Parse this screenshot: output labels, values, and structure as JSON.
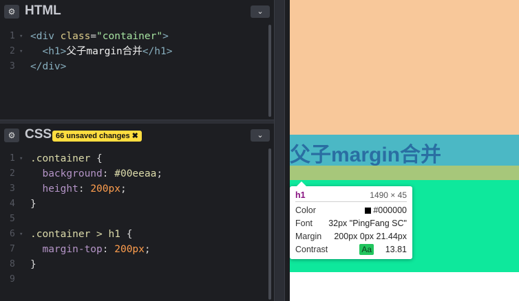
{
  "html_panel": {
    "title": "HTML",
    "lines": [
      {
        "n": "1",
        "parts": [
          {
            "t": "<div ",
            "c": "c-tag"
          },
          {
            "t": "class",
            "c": "c-attr"
          },
          {
            "t": "=",
            "c": "c-punc"
          },
          {
            "t": "\"container\"",
            "c": "c-str"
          },
          {
            "t": ">",
            "c": "c-tag"
          }
        ]
      },
      {
        "n": "2",
        "parts": [
          {
            "t": "  <h1>",
            "c": "c-tag"
          },
          {
            "t": "父子margin合并",
            "c": "c-txt"
          },
          {
            "t": "</h1>",
            "c": "c-tag"
          }
        ]
      },
      {
        "n": "3",
        "parts": [
          {
            "t": "</div>",
            "c": "c-tag"
          }
        ]
      }
    ]
  },
  "css_panel": {
    "title": "CSS",
    "badge": "66 unsaved changes ✖",
    "lines": [
      {
        "n": "1",
        "parts": [
          {
            "t": ".container ",
            "c": "c-sel"
          },
          {
            "t": "{",
            "c": "c-punc"
          }
        ]
      },
      {
        "n": "2",
        "parts": [
          {
            "t": "  background",
            "c": "c-prop"
          },
          {
            "t": ": ",
            "c": "c-punc"
          },
          {
            "t": "#00eeaa",
            "c": "c-sel"
          },
          {
            "t": ";",
            "c": "c-punc"
          }
        ]
      },
      {
        "n": "3",
        "parts": [
          {
            "t": "  height",
            "c": "c-prop"
          },
          {
            "t": ": ",
            "c": "c-punc"
          },
          {
            "t": "200px",
            "c": "c-val"
          },
          {
            "t": ";",
            "c": "c-punc"
          }
        ]
      },
      {
        "n": "4",
        "parts": [
          {
            "t": "}",
            "c": "c-punc"
          }
        ]
      },
      {
        "n": "5",
        "parts": []
      },
      {
        "n": "6",
        "parts": [
          {
            "t": ".container > h1 ",
            "c": "c-sel"
          },
          {
            "t": "{",
            "c": "c-punc"
          }
        ]
      },
      {
        "n": "7",
        "parts": [
          {
            "t": "  margin-top",
            "c": "c-prop"
          },
          {
            "t": ": ",
            "c": "c-punc"
          },
          {
            "t": "200px",
            "c": "c-val"
          },
          {
            "t": ";",
            "c": "c-punc"
          }
        ]
      },
      {
        "n": "8",
        "parts": [
          {
            "t": "}",
            "c": "c-punc"
          }
        ]
      },
      {
        "n": "9",
        "parts": []
      }
    ]
  },
  "icons": {
    "gear": "⚙",
    "chevron": "⌄",
    "fold": "▾"
  },
  "preview": {
    "heading": "父子margin合并"
  },
  "tooltip": {
    "tag": "h1",
    "size": "1490 × 45",
    "rows": [
      {
        "key": "Color",
        "value": "#000000"
      },
      {
        "key": "Font",
        "value": "32px \"PingFang SC\""
      },
      {
        "key": "Margin",
        "value": "200px 0px 21.44px"
      },
      {
        "key": "Contrast",
        "value": "13.81",
        "aa": "Aa"
      }
    ]
  },
  "colors": {
    "editor_bg": "#1d1e22",
    "badge": "#ffdd40",
    "margin_peach": "#f8c89a",
    "element_blue": "#4bb8c5",
    "margin_olive": "#a7c77a",
    "container_green": "#0ee89c"
  }
}
